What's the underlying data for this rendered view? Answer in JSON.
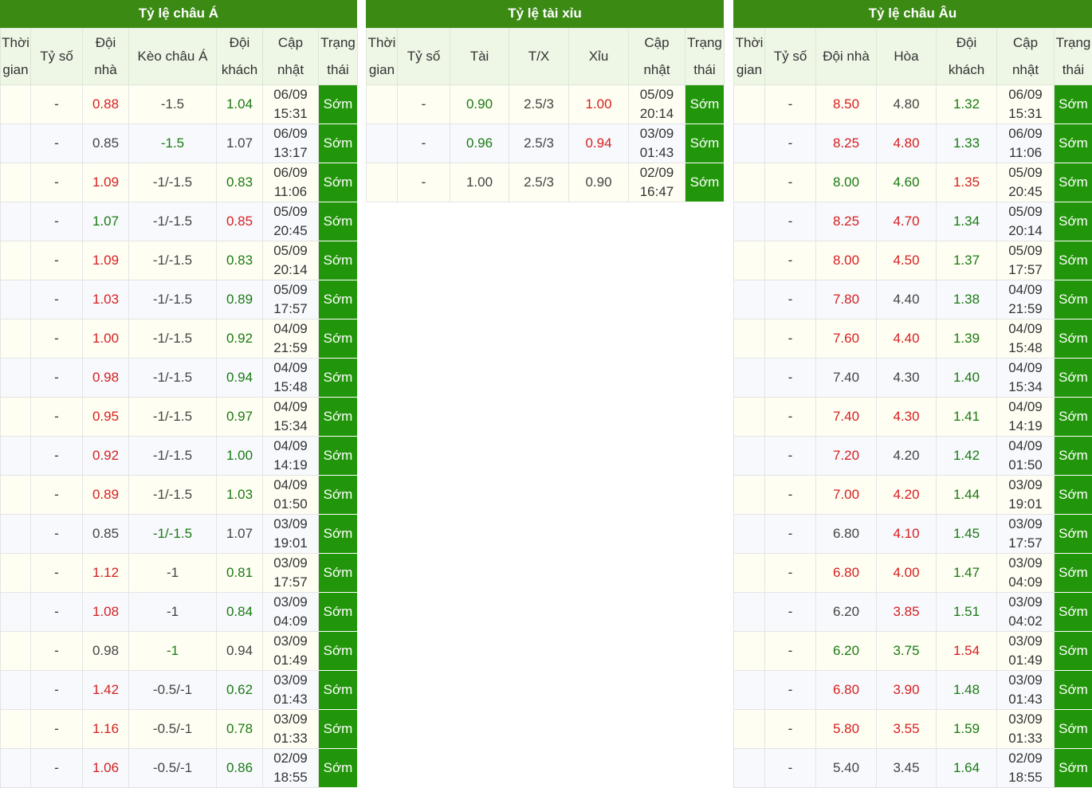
{
  "colors": {
    "header_bg": "#3b8a14",
    "subheader_bg": "#eef7e6",
    "status_bg": "#22960a",
    "up": "#d61f1f",
    "down": "#1a7a12"
  },
  "asian": {
    "title": "Tỷ lệ châu Á",
    "headers": [
      "Thời\ngian",
      "Tỷ số",
      "Đội\nnhà",
      "Kèo châu Á",
      "Đội\nkhách",
      "Cập\nnhật",
      "Trạng\nthái"
    ],
    "rows": [
      {
        "time": "",
        "score": "-",
        "home": "0.88",
        "home_c": "red",
        "line": "-1.5",
        "line_c": "def",
        "away": "1.04",
        "away_c": "green",
        "upd": "06/09\n15:31",
        "status": "Sớm"
      },
      {
        "time": "",
        "score": "-",
        "home": "0.85",
        "home_c": "def",
        "line": "-1.5",
        "line_c": "green",
        "away": "1.07",
        "away_c": "def",
        "upd": "06/09\n13:17",
        "status": "Sớm"
      },
      {
        "time": "",
        "score": "-",
        "home": "1.09",
        "home_c": "red",
        "line": "-1/-1.5",
        "line_c": "def",
        "away": "0.83",
        "away_c": "green",
        "upd": "06/09\n11:06",
        "status": "Sớm"
      },
      {
        "time": "",
        "score": "-",
        "home": "1.07",
        "home_c": "green",
        "line": "-1/-1.5",
        "line_c": "def",
        "away": "0.85",
        "away_c": "red",
        "upd": "05/09\n20:45",
        "status": "Sớm"
      },
      {
        "time": "",
        "score": "-",
        "home": "1.09",
        "home_c": "red",
        "line": "-1/-1.5",
        "line_c": "def",
        "away": "0.83",
        "away_c": "green",
        "upd": "05/09\n20:14",
        "status": "Sớm"
      },
      {
        "time": "",
        "score": "-",
        "home": "1.03",
        "home_c": "red",
        "line": "-1/-1.5",
        "line_c": "def",
        "away": "0.89",
        "away_c": "green",
        "upd": "05/09\n17:57",
        "status": "Sớm"
      },
      {
        "time": "",
        "score": "-",
        "home": "1.00",
        "home_c": "red",
        "line": "-1/-1.5",
        "line_c": "def",
        "away": "0.92",
        "away_c": "green",
        "upd": "04/09\n21:59",
        "status": "Sớm"
      },
      {
        "time": "",
        "score": "-",
        "home": "0.98",
        "home_c": "red",
        "line": "-1/-1.5",
        "line_c": "def",
        "away": "0.94",
        "away_c": "green",
        "upd": "04/09\n15:48",
        "status": "Sớm"
      },
      {
        "time": "",
        "score": "-",
        "home": "0.95",
        "home_c": "red",
        "line": "-1/-1.5",
        "line_c": "def",
        "away": "0.97",
        "away_c": "green",
        "upd": "04/09\n15:34",
        "status": "Sớm"
      },
      {
        "time": "",
        "score": "-",
        "home": "0.92",
        "home_c": "red",
        "line": "-1/-1.5",
        "line_c": "def",
        "away": "1.00",
        "away_c": "green",
        "upd": "04/09\n14:19",
        "status": "Sớm"
      },
      {
        "time": "",
        "score": "-",
        "home": "0.89",
        "home_c": "red",
        "line": "-1/-1.5",
        "line_c": "def",
        "away": "1.03",
        "away_c": "green",
        "upd": "04/09\n01:50",
        "status": "Sớm"
      },
      {
        "time": "",
        "score": "-",
        "home": "0.85",
        "home_c": "def",
        "line": "-1/-1.5",
        "line_c": "green",
        "away": "1.07",
        "away_c": "def",
        "upd": "03/09\n19:01",
        "status": "Sớm"
      },
      {
        "time": "",
        "score": "-",
        "home": "1.12",
        "home_c": "red",
        "line": "-1",
        "line_c": "def",
        "away": "0.81",
        "away_c": "green",
        "upd": "03/09\n17:57",
        "status": "Sớm"
      },
      {
        "time": "",
        "score": "-",
        "home": "1.08",
        "home_c": "red",
        "line": "-1",
        "line_c": "def",
        "away": "0.84",
        "away_c": "green",
        "upd": "03/09\n04:09",
        "status": "Sớm"
      },
      {
        "time": "",
        "score": "-",
        "home": "0.98",
        "home_c": "def",
        "line": "-1",
        "line_c": "green",
        "away": "0.94",
        "away_c": "def",
        "upd": "03/09\n01:49",
        "status": "Sớm"
      },
      {
        "time": "",
        "score": "-",
        "home": "1.42",
        "home_c": "red",
        "line": "-0.5/-1",
        "line_c": "def",
        "away": "0.62",
        "away_c": "green",
        "upd": "03/09\n01:43",
        "status": "Sớm"
      },
      {
        "time": "",
        "score": "-",
        "home": "1.16",
        "home_c": "red",
        "line": "-0.5/-1",
        "line_c": "def",
        "away": "0.78",
        "away_c": "green",
        "upd": "03/09\n01:33",
        "status": "Sớm"
      },
      {
        "time": "",
        "score": "-",
        "home": "1.06",
        "home_c": "red",
        "line": "-0.5/-1",
        "line_c": "def",
        "away": "0.86",
        "away_c": "green",
        "upd": "02/09\n18:55",
        "status": "Sớm"
      }
    ]
  },
  "overunder": {
    "title": "Tỷ lệ tài xỉu",
    "headers": [
      "Thời\ngian",
      "Tỷ số",
      "Tài",
      "T/X",
      "Xỉu",
      "Cập\nnhật",
      "Trạng\nthái"
    ],
    "rows": [
      {
        "time": "",
        "score": "-",
        "over": "0.90",
        "over_c": "green",
        "line": "2.5/3",
        "line_c": "def",
        "under": "1.00",
        "under_c": "red",
        "upd": "05/09\n20:14",
        "status": "Sớm"
      },
      {
        "time": "",
        "score": "-",
        "over": "0.96",
        "over_c": "green",
        "line": "2.5/3",
        "line_c": "def",
        "under": "0.94",
        "under_c": "red",
        "upd": "03/09\n01:43",
        "status": "Sớm"
      },
      {
        "time": "",
        "score": "-",
        "over": "1.00",
        "over_c": "def",
        "line": "2.5/3",
        "line_c": "def",
        "under": "0.90",
        "under_c": "def",
        "upd": "02/09\n16:47",
        "status": "Sớm"
      }
    ]
  },
  "european": {
    "title": "Tỷ lệ châu Âu",
    "headers": [
      "Thời\ngian",
      "Tỷ số",
      "Đội nhà",
      "Hòa",
      "Đội\nkhách",
      "Cập\nnhật",
      "Trạng\nthái"
    ],
    "rows": [
      {
        "time": "",
        "score": "-",
        "home": "8.50",
        "home_c": "red",
        "draw": "4.80",
        "draw_c": "def",
        "away": "1.32",
        "away_c": "green",
        "upd": "06/09\n15:31",
        "status": "Sớm"
      },
      {
        "time": "",
        "score": "-",
        "home": "8.25",
        "home_c": "red",
        "draw": "4.80",
        "draw_c": "red",
        "away": "1.33",
        "away_c": "green",
        "upd": "06/09\n11:06",
        "status": "Sớm"
      },
      {
        "time": "",
        "score": "-",
        "home": "8.00",
        "home_c": "green",
        "draw": "4.60",
        "draw_c": "green",
        "away": "1.35",
        "away_c": "red",
        "upd": "05/09\n20:45",
        "status": "Sớm"
      },
      {
        "time": "",
        "score": "-",
        "home": "8.25",
        "home_c": "red",
        "draw": "4.70",
        "draw_c": "red",
        "away": "1.34",
        "away_c": "green",
        "upd": "05/09\n20:14",
        "status": "Sớm"
      },
      {
        "time": "",
        "score": "-",
        "home": "8.00",
        "home_c": "red",
        "draw": "4.50",
        "draw_c": "red",
        "away": "1.37",
        "away_c": "green",
        "upd": "05/09\n17:57",
        "status": "Sớm"
      },
      {
        "time": "",
        "score": "-",
        "home": "7.80",
        "home_c": "red",
        "draw": "4.40",
        "draw_c": "def",
        "away": "1.38",
        "away_c": "green",
        "upd": "04/09\n21:59",
        "status": "Sớm"
      },
      {
        "time": "",
        "score": "-",
        "home": "7.60",
        "home_c": "red",
        "draw": "4.40",
        "draw_c": "red",
        "away": "1.39",
        "away_c": "green",
        "upd": "04/09\n15:48",
        "status": "Sớm"
      },
      {
        "time": "",
        "score": "-",
        "home": "7.40",
        "home_c": "def",
        "draw": "4.30",
        "draw_c": "def",
        "away": "1.40",
        "away_c": "green",
        "upd": "04/09\n15:34",
        "status": "Sớm"
      },
      {
        "time": "",
        "score": "-",
        "home": "7.40",
        "home_c": "red",
        "draw": "4.30",
        "draw_c": "red",
        "away": "1.41",
        "away_c": "green",
        "upd": "04/09\n14:19",
        "status": "Sớm"
      },
      {
        "time": "",
        "score": "-",
        "home": "7.20",
        "home_c": "red",
        "draw": "4.20",
        "draw_c": "def",
        "away": "1.42",
        "away_c": "green",
        "upd": "04/09\n01:50",
        "status": "Sớm"
      },
      {
        "time": "",
        "score": "-",
        "home": "7.00",
        "home_c": "red",
        "draw": "4.20",
        "draw_c": "red",
        "away": "1.44",
        "away_c": "green",
        "upd": "03/09\n19:01",
        "status": "Sớm"
      },
      {
        "time": "",
        "score": "-",
        "home": "6.80",
        "home_c": "def",
        "draw": "4.10",
        "draw_c": "red",
        "away": "1.45",
        "away_c": "green",
        "upd": "03/09\n17:57",
        "status": "Sớm"
      },
      {
        "time": "",
        "score": "-",
        "home": "6.80",
        "home_c": "red",
        "draw": "4.00",
        "draw_c": "red",
        "away": "1.47",
        "away_c": "green",
        "upd": "03/09\n04:09",
        "status": "Sớm"
      },
      {
        "time": "",
        "score": "-",
        "home": "6.20",
        "home_c": "def",
        "draw": "3.85",
        "draw_c": "red",
        "away": "1.51",
        "away_c": "green",
        "upd": "03/09\n04:02",
        "status": "Sớm"
      },
      {
        "time": "",
        "score": "-",
        "home": "6.20",
        "home_c": "green",
        "draw": "3.75",
        "draw_c": "green",
        "away": "1.54",
        "away_c": "red",
        "upd": "03/09\n01:49",
        "status": "Sớm"
      },
      {
        "time": "",
        "score": "-",
        "home": "6.80",
        "home_c": "red",
        "draw": "3.90",
        "draw_c": "red",
        "away": "1.48",
        "away_c": "green",
        "upd": "03/09\n01:43",
        "status": "Sớm"
      },
      {
        "time": "",
        "score": "-",
        "home": "5.80",
        "home_c": "red",
        "draw": "3.55",
        "draw_c": "red",
        "away": "1.59",
        "away_c": "green",
        "upd": "03/09\n01:33",
        "status": "Sớm"
      },
      {
        "time": "",
        "score": "-",
        "home": "5.40",
        "home_c": "def",
        "draw": "3.45",
        "draw_c": "def",
        "away": "1.64",
        "away_c": "green",
        "upd": "02/09\n18:55",
        "status": "Sớm"
      }
    ]
  }
}
